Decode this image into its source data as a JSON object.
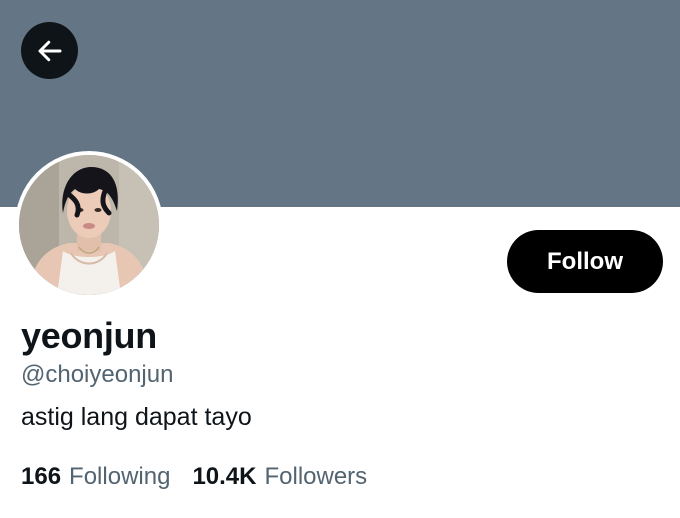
{
  "profile": {
    "name": "yeonjun",
    "handle": "@choiyeonjun",
    "bio": "astig lang dapat tayo",
    "follow_label": "Follow"
  },
  "stats": {
    "following_count": "166",
    "following_label": "Following",
    "followers_count": "10.4K",
    "followers_label": "Followers"
  },
  "icons": {
    "back": "arrow-left-icon"
  },
  "colors": {
    "banner": "#647686",
    "text_primary": "#0f1419",
    "text_secondary": "#536471",
    "follow_button": "#000000"
  }
}
